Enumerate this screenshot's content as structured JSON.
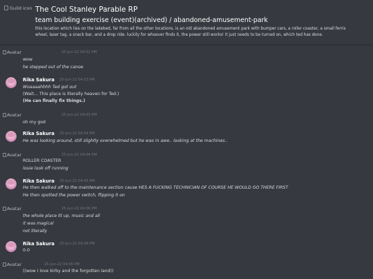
{
  "header": {
    "guild_icon_alt": "Guild icon",
    "guild_name": "The Cool Stanley Parable RP",
    "channel": "team building exercise (event)(archived) / abandoned-amusement-park",
    "topic": "this location which lies on the lakebed, far from all the other locations, is an old abandoned amusement park with bumper cars, a roller coaster, a small ferris wheel, laser tag, a snack bar, and a drop ride. luckily for whoever finds it, the power still works! it just needs to be turned on, which ted has done."
  },
  "avatar_alt": "Avatar",
  "messages": [
    {
      "author": "",
      "author_color": "#e74c3c",
      "timestamp": "25-Jun-22 04:02 PM",
      "lines": [
        "wow",
        "he stepped out of the canoe"
      ]
    },
    {
      "author": "Rika Sakura",
      "author_color": "#ffffff",
      "timestamp": "25-Jun-22 04:03 PM",
      "lines": [
        "Woaaaahhhh Ted got out",
        "(Wait... This place is literally heaven for Ted.)",
        "(He can finally fix things.)"
      ]
    },
    {
      "author": "",
      "author_color": "#e74c3c",
      "timestamp": "25-Jun-22 04:03 PM",
      "lines": [
        "oh my god"
      ]
    },
    {
      "author": "Rika Sakura",
      "author_color": "#ffffff",
      "timestamp": "25-Jun-22 04:04 PM",
      "lines": [
        "He was looking around, still slightly overwhelmed but he was in awe.. looking at the machines.."
      ]
    },
    {
      "author": "",
      "author_color": "#e74c3c",
      "timestamp": "25-Jun-22 04:04 PM",
      "lines": [
        "ROLLER COASTER",
        "louie look off running"
      ]
    },
    {
      "author": "Rika Sakura",
      "author_color": "#ffffff",
      "timestamp": "25-Jun-22 04:05 PM",
      "lines": [
        "He then walked off to the maintenance section cause HES A FUCKING TECHNICIAN OF COURSE HE WOULD GO THERE FIRST",
        "He then spotted the power switch, flipping it on"
      ]
    },
    {
      "author": "",
      "author_color": "#e74c3c",
      "timestamp": "25-Jun-22 04:06 PM",
      "lines": [
        "the whole place lit up, music and all",
        "it was magical",
        "not literally"
      ]
    },
    {
      "author": "Rika Sakura",
      "author_color": "#ffffff",
      "timestamp": "25-Jun-22 04:06 PM",
      "lines": [
        "0-0"
      ]
    },
    {
      "author": "",
      "author_color": "#4f83d6",
      "timestamp": "25-Jun-22 04:06 PM",
      "lines": [
        "((wow i love kirby and the forgotten land))"
      ]
    }
  ]
}
